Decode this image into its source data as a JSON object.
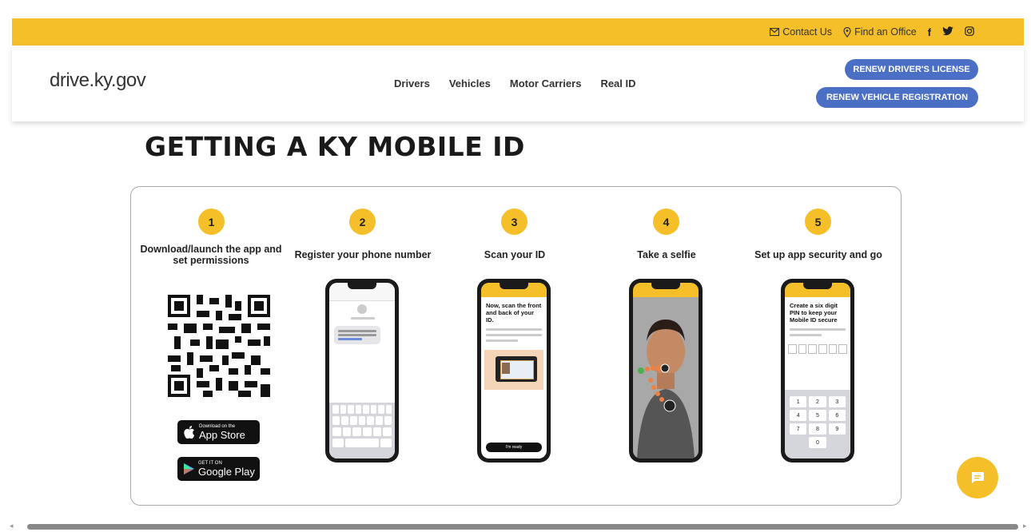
{
  "topbar": {
    "contact": "Contact Us",
    "find_office": "Find an Office",
    "facebook": "f",
    "twitter_icon": "twitter-icon",
    "instagram_icon": "instagram-icon"
  },
  "header": {
    "logo": "drive.ky.gov",
    "nav": [
      "Drivers",
      "Vehicles",
      "Motor Carriers",
      "Real ID"
    ],
    "btn_renew_license": "RENEW DRIVER'S LICENSE",
    "btn_renew_vehicle": "RENEW VEHICLE REGISTRATION"
  },
  "page_title": "GETTING A KY MOBILE ID",
  "steps": [
    {
      "num": "1",
      "title": "Download/launch the app and set permissions"
    },
    {
      "num": "2",
      "title": "Register your phone number"
    },
    {
      "num": "3",
      "title": "Scan your ID"
    },
    {
      "num": "4",
      "title": "Take a selfie"
    },
    {
      "num": "5",
      "title": "Set up app security and go"
    }
  ],
  "phone3": {
    "heading": "Now, scan the front and back of your ID.",
    "button": "I'm ready"
  },
  "phone5": {
    "heading": "Create a six digit PIN to keep your Mobile ID secure",
    "keys": [
      "1",
      "2",
      "3",
      "4",
      "5",
      "6",
      "7",
      "8",
      "9",
      "0"
    ]
  },
  "stores": {
    "apple_small": "Download on the",
    "apple_big": "App Store",
    "google_small": "GET IT ON",
    "google_big": "Google Play"
  },
  "colors": {
    "accent": "#f5bf2a",
    "button": "#4a6fc4"
  }
}
